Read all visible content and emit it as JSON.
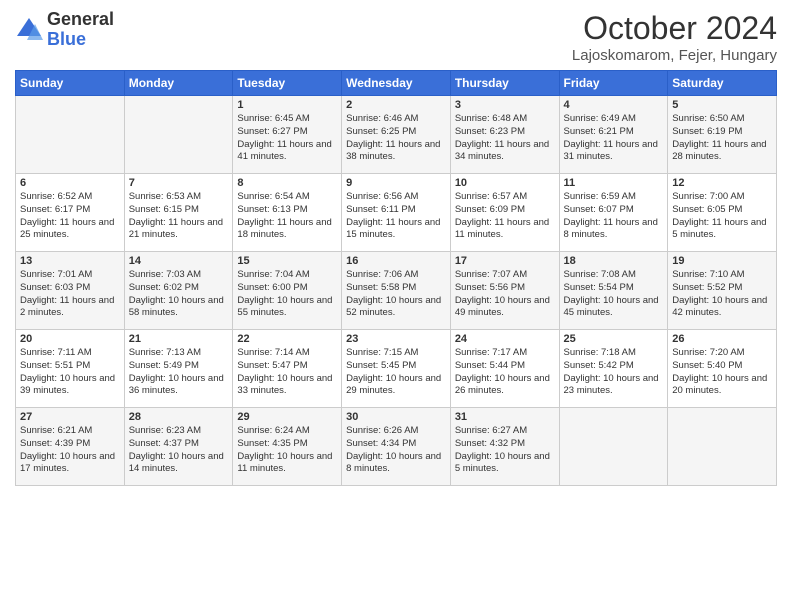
{
  "logo": {
    "general": "General",
    "blue": "Blue"
  },
  "title": {
    "month": "October 2024",
    "location": "Lajoskomarom, Fejer, Hungary"
  },
  "days_of_week": [
    "Sunday",
    "Monday",
    "Tuesday",
    "Wednesday",
    "Thursday",
    "Friday",
    "Saturday"
  ],
  "weeks": [
    [
      {
        "day": "",
        "content": ""
      },
      {
        "day": "",
        "content": ""
      },
      {
        "day": "1",
        "content": "Sunrise: 6:45 AM\nSunset: 6:27 PM\nDaylight: 11 hours and 41 minutes."
      },
      {
        "day": "2",
        "content": "Sunrise: 6:46 AM\nSunset: 6:25 PM\nDaylight: 11 hours and 38 minutes."
      },
      {
        "day": "3",
        "content": "Sunrise: 6:48 AM\nSunset: 6:23 PM\nDaylight: 11 hours and 34 minutes."
      },
      {
        "day": "4",
        "content": "Sunrise: 6:49 AM\nSunset: 6:21 PM\nDaylight: 11 hours and 31 minutes."
      },
      {
        "day": "5",
        "content": "Sunrise: 6:50 AM\nSunset: 6:19 PM\nDaylight: 11 hours and 28 minutes."
      }
    ],
    [
      {
        "day": "6",
        "content": "Sunrise: 6:52 AM\nSunset: 6:17 PM\nDaylight: 11 hours and 25 minutes."
      },
      {
        "day": "7",
        "content": "Sunrise: 6:53 AM\nSunset: 6:15 PM\nDaylight: 11 hours and 21 minutes."
      },
      {
        "day": "8",
        "content": "Sunrise: 6:54 AM\nSunset: 6:13 PM\nDaylight: 11 hours and 18 minutes."
      },
      {
        "day": "9",
        "content": "Sunrise: 6:56 AM\nSunset: 6:11 PM\nDaylight: 11 hours and 15 minutes."
      },
      {
        "day": "10",
        "content": "Sunrise: 6:57 AM\nSunset: 6:09 PM\nDaylight: 11 hours and 11 minutes."
      },
      {
        "day": "11",
        "content": "Sunrise: 6:59 AM\nSunset: 6:07 PM\nDaylight: 11 hours and 8 minutes."
      },
      {
        "day": "12",
        "content": "Sunrise: 7:00 AM\nSunset: 6:05 PM\nDaylight: 11 hours and 5 minutes."
      }
    ],
    [
      {
        "day": "13",
        "content": "Sunrise: 7:01 AM\nSunset: 6:03 PM\nDaylight: 11 hours and 2 minutes."
      },
      {
        "day": "14",
        "content": "Sunrise: 7:03 AM\nSunset: 6:02 PM\nDaylight: 10 hours and 58 minutes."
      },
      {
        "day": "15",
        "content": "Sunrise: 7:04 AM\nSunset: 6:00 PM\nDaylight: 10 hours and 55 minutes."
      },
      {
        "day": "16",
        "content": "Sunrise: 7:06 AM\nSunset: 5:58 PM\nDaylight: 10 hours and 52 minutes."
      },
      {
        "day": "17",
        "content": "Sunrise: 7:07 AM\nSunset: 5:56 PM\nDaylight: 10 hours and 49 minutes."
      },
      {
        "day": "18",
        "content": "Sunrise: 7:08 AM\nSunset: 5:54 PM\nDaylight: 10 hours and 45 minutes."
      },
      {
        "day": "19",
        "content": "Sunrise: 7:10 AM\nSunset: 5:52 PM\nDaylight: 10 hours and 42 minutes."
      }
    ],
    [
      {
        "day": "20",
        "content": "Sunrise: 7:11 AM\nSunset: 5:51 PM\nDaylight: 10 hours and 39 minutes."
      },
      {
        "day": "21",
        "content": "Sunrise: 7:13 AM\nSunset: 5:49 PM\nDaylight: 10 hours and 36 minutes."
      },
      {
        "day": "22",
        "content": "Sunrise: 7:14 AM\nSunset: 5:47 PM\nDaylight: 10 hours and 33 minutes."
      },
      {
        "day": "23",
        "content": "Sunrise: 7:15 AM\nSunset: 5:45 PM\nDaylight: 10 hours and 29 minutes."
      },
      {
        "day": "24",
        "content": "Sunrise: 7:17 AM\nSunset: 5:44 PM\nDaylight: 10 hours and 26 minutes."
      },
      {
        "day": "25",
        "content": "Sunrise: 7:18 AM\nSunset: 5:42 PM\nDaylight: 10 hours and 23 minutes."
      },
      {
        "day": "26",
        "content": "Sunrise: 7:20 AM\nSunset: 5:40 PM\nDaylight: 10 hours and 20 minutes."
      }
    ],
    [
      {
        "day": "27",
        "content": "Sunrise: 6:21 AM\nSunset: 4:39 PM\nDaylight: 10 hours and 17 minutes."
      },
      {
        "day": "28",
        "content": "Sunrise: 6:23 AM\nSunset: 4:37 PM\nDaylight: 10 hours and 14 minutes."
      },
      {
        "day": "29",
        "content": "Sunrise: 6:24 AM\nSunset: 4:35 PM\nDaylight: 10 hours and 11 minutes."
      },
      {
        "day": "30",
        "content": "Sunrise: 6:26 AM\nSunset: 4:34 PM\nDaylight: 10 hours and 8 minutes."
      },
      {
        "day": "31",
        "content": "Sunrise: 6:27 AM\nSunset: 4:32 PM\nDaylight: 10 hours and 5 minutes."
      },
      {
        "day": "",
        "content": ""
      },
      {
        "day": "",
        "content": ""
      }
    ]
  ]
}
